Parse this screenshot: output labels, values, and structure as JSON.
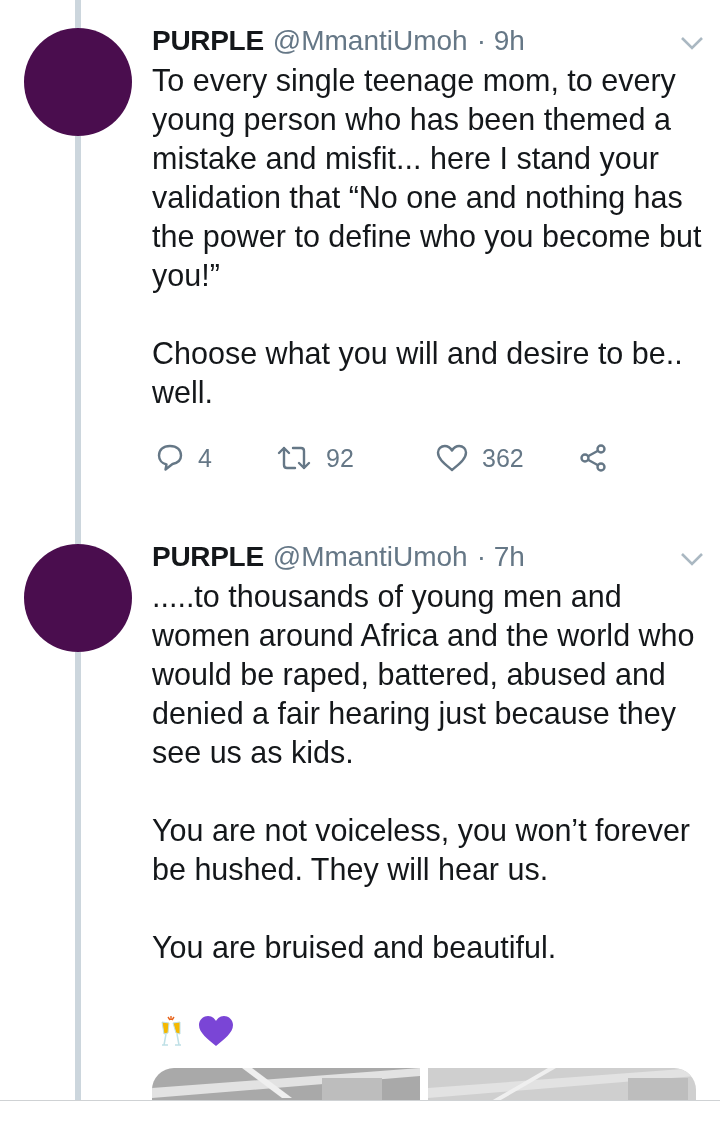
{
  "tweets": [
    {
      "name": "PURPLE",
      "handle": "@MmantiUmoh",
      "time": "· 9h",
      "paragraphs": [
        "To every single teenage mom, to every young person who has been themed a mistake and misfit... here I stand your validation that “No one and nothing has the power to define who you become but you!”",
        "Choose what you will and desire to be.. well."
      ],
      "actions": {
        "replies": "4",
        "retweets": "92",
        "likes": "362"
      }
    },
    {
      "name": "PURPLE",
      "handle": "@MmantiUmoh",
      "time": "· 7h",
      "paragraphs": [
        ".....to thousands of young men and women around Africa and the world who would be raped, battered, abused and denied a fair hearing just because they see us as kids.",
        "You are not voiceless, you won’t forever be hushed. They will hear us.",
        "You are bruised and beautiful."
      ],
      "emoji_line": true
    }
  ]
}
